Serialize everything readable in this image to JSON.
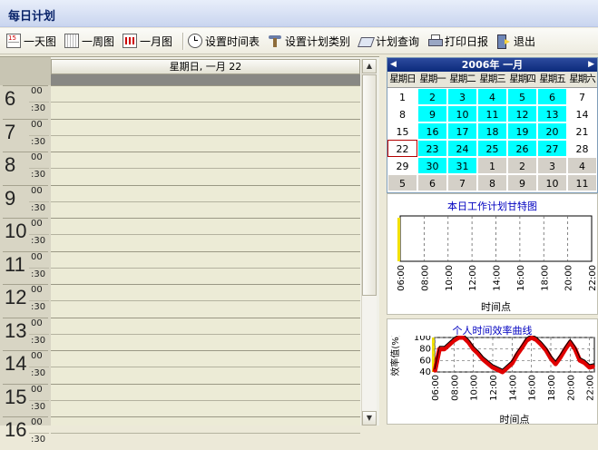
{
  "window": {
    "title": "每日计划"
  },
  "toolbar": {
    "items": [
      {
        "label": "一天图",
        "icon": "day-view-icon"
      },
      {
        "label": "一周图",
        "icon": "week-view-icon"
      },
      {
        "label": "一月图",
        "icon": "month-view-icon"
      },
      {
        "label": "设置时间表",
        "icon": "clock-icon"
      },
      {
        "label": "设置计划类别",
        "icon": "category-icon"
      },
      {
        "label": "计划查询",
        "icon": "search-icon"
      },
      {
        "label": "打印日报",
        "icon": "printer-icon"
      },
      {
        "label": "退出",
        "icon": "exit-icon"
      }
    ]
  },
  "day_view": {
    "header": "星期日, 一月 22",
    "hours": [
      "6",
      "7",
      "8",
      "9",
      "10",
      "11",
      "12",
      "13",
      "14",
      "15",
      "16"
    ],
    "minute_full": "00",
    "minute_half": ":30"
  },
  "mini_calendar": {
    "title": "2006年  一月",
    "weekdays": [
      "星期日",
      "星期一",
      "星期二",
      "星期三",
      "星期四",
      "星期五",
      "星期六"
    ],
    "weeks": [
      [
        "1",
        "2",
        "3",
        "4",
        "5",
        "6",
        "7"
      ],
      [
        "8",
        "9",
        "10",
        "11",
        "12",
        "13",
        "14"
      ],
      [
        "15",
        "16",
        "17",
        "18",
        "19",
        "20",
        "21"
      ],
      [
        "22",
        "23",
        "24",
        "25",
        "26",
        "27",
        "28"
      ],
      [
        "29",
        "30",
        "31",
        "1",
        "2",
        "3",
        "4"
      ],
      [
        "5",
        "6",
        "7",
        "8",
        "9",
        "10",
        "11"
      ]
    ],
    "selected_day": "22",
    "colors": {
      "work_day": "#00ffff",
      "other_month": "#d4d0c8",
      "header": "#0b2a7b"
    }
  },
  "chart_data": [
    {
      "type": "bar",
      "title": "本日工作计划甘特图",
      "xlabel": "时间点",
      "ylabel": "",
      "x_ticks": [
        "06:00",
        "08:00",
        "10:00",
        "12:00",
        "14:00",
        "16:00",
        "18:00",
        "20:00",
        "22:00"
      ],
      "series": []
    },
    {
      "type": "line",
      "title": "个人时间效率曲线",
      "xlabel": "时间点",
      "ylabel": "效率值(%)",
      "ylim": [
        40,
        100
      ],
      "y_ticks": [
        "100",
        "80",
        "60",
        "40"
      ],
      "x_ticks": [
        "06:00",
        "08:00",
        "10:00",
        "12:00",
        "14:00",
        "16:00",
        "18:00",
        "20:00",
        "22:00"
      ],
      "x": [
        6.0,
        6.5,
        7.0,
        8.0,
        8.5,
        9.0,
        9.5,
        10.0,
        10.5,
        11.0,
        11.5,
        12.0,
        13.0,
        14.0,
        14.5,
        15.0,
        15.5,
        16.0,
        16.5,
        17.0,
        17.5,
        18.0,
        18.5,
        19.0,
        19.5,
        20.0,
        20.5,
        21.0,
        21.5,
        22.0,
        22.5
      ],
      "y": [
        40,
        80,
        80,
        95,
        100,
        100,
        92,
        80,
        72,
        62,
        55,
        48,
        40,
        55,
        70,
        82,
        95,
        100,
        96,
        88,
        78,
        64,
        54,
        66,
        80,
        92,
        80,
        60,
        56,
        48,
        50
      ],
      "colors": {
        "line": "#000000",
        "band": "#e00000"
      }
    }
  ]
}
